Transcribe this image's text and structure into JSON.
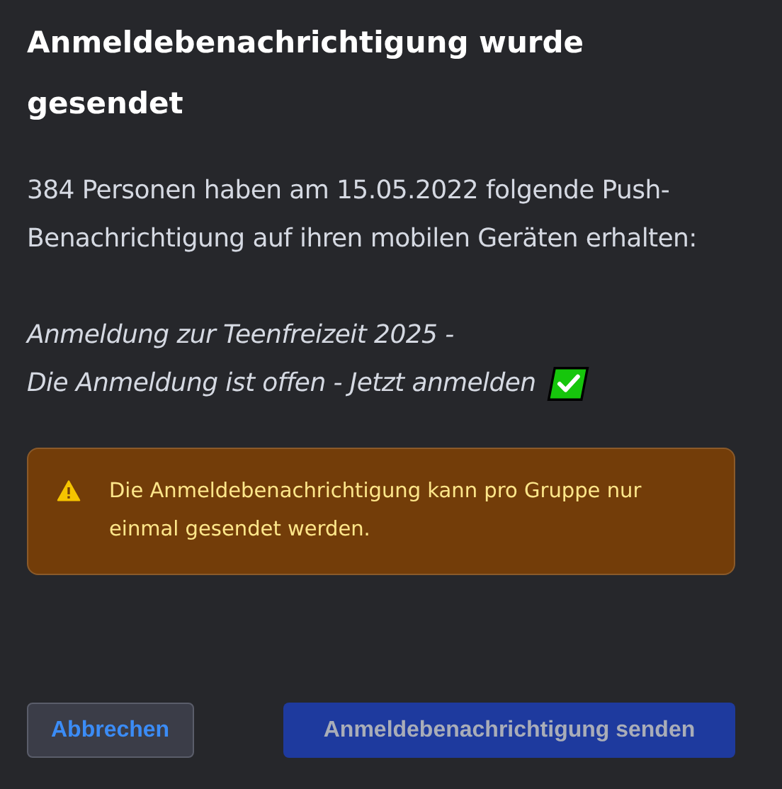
{
  "title": "Anmeldebenachrichtigung wurde gesendet",
  "summary": "384 Personen haben am 15.05.2022 folgende Push-Benachrichtigung auf ihren mobilen Geräten erhalten:",
  "message_lines": [
    "Anmeldung zur Teenfreizeit 2025 -",
    "Die Anmeldung ist offen - Jetzt anmelden"
  ],
  "alert": {
    "kind": "warning",
    "text": "Die Anmeldebenachrichtigung kann pro Gruppe nur einmal gesendet werden."
  },
  "buttons": [
    {
      "label": "Abbrechen",
      "kind": "secondary",
      "disabled": false
    },
    {
      "label": "Anmeldebenachrichtigung senden",
      "kind": "primary",
      "disabled": true
    }
  ]
}
